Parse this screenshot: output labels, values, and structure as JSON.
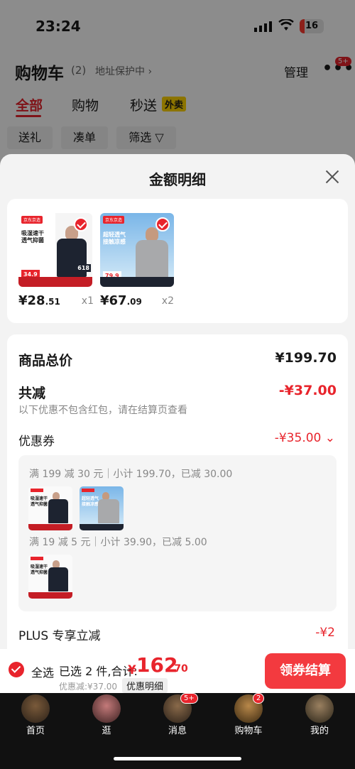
{
  "status": {
    "time": "23:24",
    "battery": "16"
  },
  "navbar": {
    "title": "购物车",
    "count": "(2)",
    "address": "地址保护中 ›",
    "manage": "管理",
    "more": "•••",
    "more_badge": "5+"
  },
  "tabs": [
    {
      "label": "全部"
    },
    {
      "label": "购物"
    },
    {
      "label": "秒送"
    }
  ],
  "waimai": "外卖",
  "filters": [
    {
      "label": "送礼"
    },
    {
      "label": "凑单"
    },
    {
      "label": "筛选 ▽"
    }
  ],
  "sheet": {
    "title": "金额明细",
    "products": [
      {
        "price_int": "¥28",
        "price_dec": ".51",
        "qty": "x1",
        "promo": "吸湿速干\n透气抑菌",
        "price_tag": "34.9",
        "tag_618": "618"
      },
      {
        "price_int": "¥67",
        "price_dec": ".09",
        "qty": "x2",
        "promo": "超轻透气\n接触凉感",
        "price_tag": "79.9"
      }
    ],
    "total_label": "商品总价",
    "total_value": "¥199.70",
    "discount_label": "共减",
    "discount_value": "-¥37.00",
    "note": "以下优惠不包含红包，请在结算页查看",
    "coupon_label": "优惠券",
    "coupon_value": "-¥35.00 ⌄",
    "coupon_rules": [
      "满 199 减 30 元｜小计 199.70，已减 30.00",
      "满 19 减 5 元｜小计 39.90，已减 5.00"
    ],
    "plus_label": "PLUS 专享立减",
    "plus_value": "-¥2"
  },
  "checkout": {
    "select_all": "全选",
    "selected": "已选 2 件,合计:",
    "currency": "¥",
    "total_int": "162",
    "total_dec": ".70",
    "discount": "优惠减:¥37.00",
    "detail": "优惠明细",
    "pay": "领券结算"
  },
  "tabbar": [
    {
      "label": "首页",
      "badge": ""
    },
    {
      "label": "逛",
      "badge": ""
    },
    {
      "label": "消息",
      "badge": "5+"
    },
    {
      "label": "购物车",
      "badge": "2"
    },
    {
      "label": "我的",
      "badge": ""
    }
  ],
  "colors": {
    "accent": "#e8242c"
  }
}
